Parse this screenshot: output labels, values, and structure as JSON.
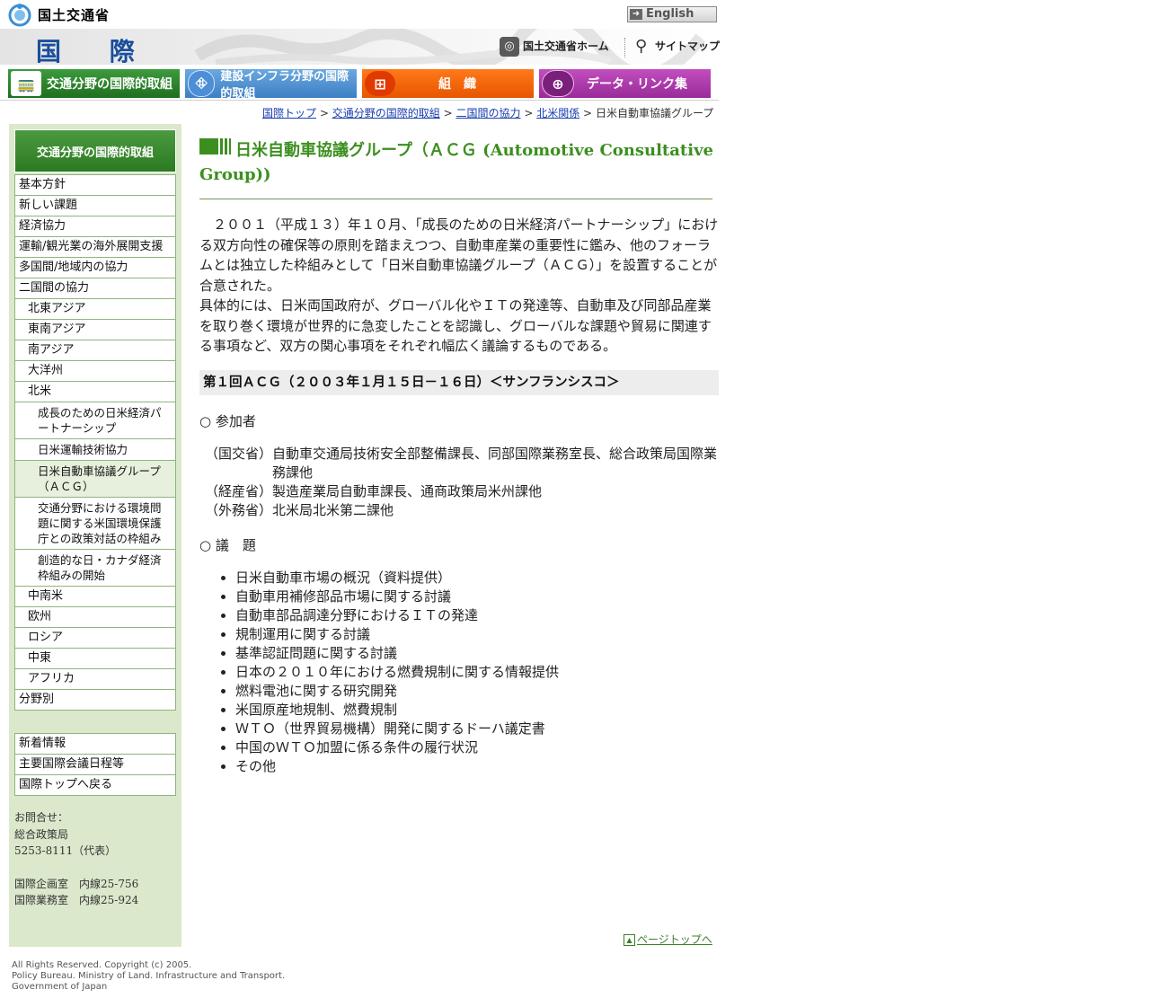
{
  "header": {
    "ministry": "国土交通省",
    "english": "English",
    "section_title": "国 際",
    "home_link": "国土交通省ホーム",
    "sitemap_link": "サイトマップ"
  },
  "nav": {
    "tabs": [
      {
        "label": "交通分野の国際的取組"
      },
      {
        "label": "建設インフラ分野の国際的取組"
      },
      {
        "label": "組　織"
      },
      {
        "label": "データ・リンク集"
      }
    ]
  },
  "breadcrumb": {
    "items": [
      "国際トップ",
      "交通分野の国際的取組",
      "二国間の協力",
      "北米関係"
    ],
    "current": "日米自動車協議グループ",
    "separator": ">"
  },
  "sidebar": {
    "heading": "交通分野の国際的取組",
    "menu1": [
      "基本方針",
      "新しい課題",
      "経済協力",
      "運輸/観光業の海外展開支援",
      "多国間/地域内の協力",
      "二国間の協力",
      "北東アジア",
      "東南アジア",
      "南アジア",
      "大洋州",
      "北米",
      "成長のための日米経済パートナーシップ",
      "日米運輸技術協力",
      "日米自動車協議グループ（ＡＣＧ）",
      "交通分野における環境問題に関する米国環境保護庁との政策対話の枠組み",
      "創造的な日・カナダ経済枠組みの開始",
      "中南米",
      "欧州",
      "ロシア",
      "中東",
      "アフリカ",
      "分野別"
    ],
    "menu2": [
      "新着情報",
      "主要国際会議日程等",
      "国際トップへ戻る"
    ],
    "contact": {
      "label": "お問合せ：",
      "dept": "総合政策局",
      "tel": "5253-8111（代表）",
      "line1": "国際企画室　内線25-756",
      "line2": "国際業務室　内線25-924"
    }
  },
  "main": {
    "title": "日米自動車協議グループ（ＡＣＧ (Automotive Consultative Group))",
    "intro1": "２００１（平成１３）年１０月、「成長のための日米経済パートナーシップ」における双方向性の確保等の原則を踏まえつつ、自動車産業の重要性に鑑み、他のフォーラムとは独立した枠組みとして「日米自動車協議グループ（ＡＣＧ）」を設置することが合意された。",
    "intro2": "具体的には、日米両国政府が、グローバル化やＩＴの発達等、自動車及び同部品産業を取り巻く環境が世界的に急変したことを認識し、グローバルな課題や貿易に関連する事項など、双方の関心事項をそれぞれ幅広く議論するものである。",
    "section": "第１回ＡＣＧ（２００３年１月１５日－１６日）＜サンフランシスコ＞",
    "participants_heading": "○ 参加者",
    "participants": [
      {
        "org": "（国交省）",
        "who": "自動車交通局技術安全部整備課長、同部国際業務室長、総合政策局国際業務課他"
      },
      {
        "org": "（経産省）",
        "who": "製造産業局自動車課長、通商政策局米州課他"
      },
      {
        "org": "（外務省）",
        "who": "北米局北米第二課他"
      }
    ],
    "agenda_heading": "○ 議　題",
    "agenda": [
      "日米自動車市場の概況（資料提供）",
      "自動車用補修部品市場に関する討議",
      "自動車部品調達分野におけるＩＴの発達",
      "規制運用に関する討議",
      "基準認証問題に関する討議",
      "日本の２０１０年における燃費規制に関する情報提供",
      "燃料電池に関する研究開発",
      "米国原産地規制、燃費規制",
      "ＷＴＯ（世界貿易機構）開発に関するドーハ議定書",
      "中国のＷＴＯ加盟に係る条件の履行状況",
      "その他"
    ],
    "pagetop": "ページトップへ"
  },
  "footer": {
    "line1": "All Rights Reserved. Copyright (c) 2005.",
    "line2": "Policy Bureau. Ministry of Land. Infrastructure and Transport.",
    "line3": "Government of Japan"
  },
  "colors": {
    "accent_green": "#3c8f1f",
    "link_blue": "#1a3fb0",
    "sidebar_bg": "#dbe8cc"
  }
}
